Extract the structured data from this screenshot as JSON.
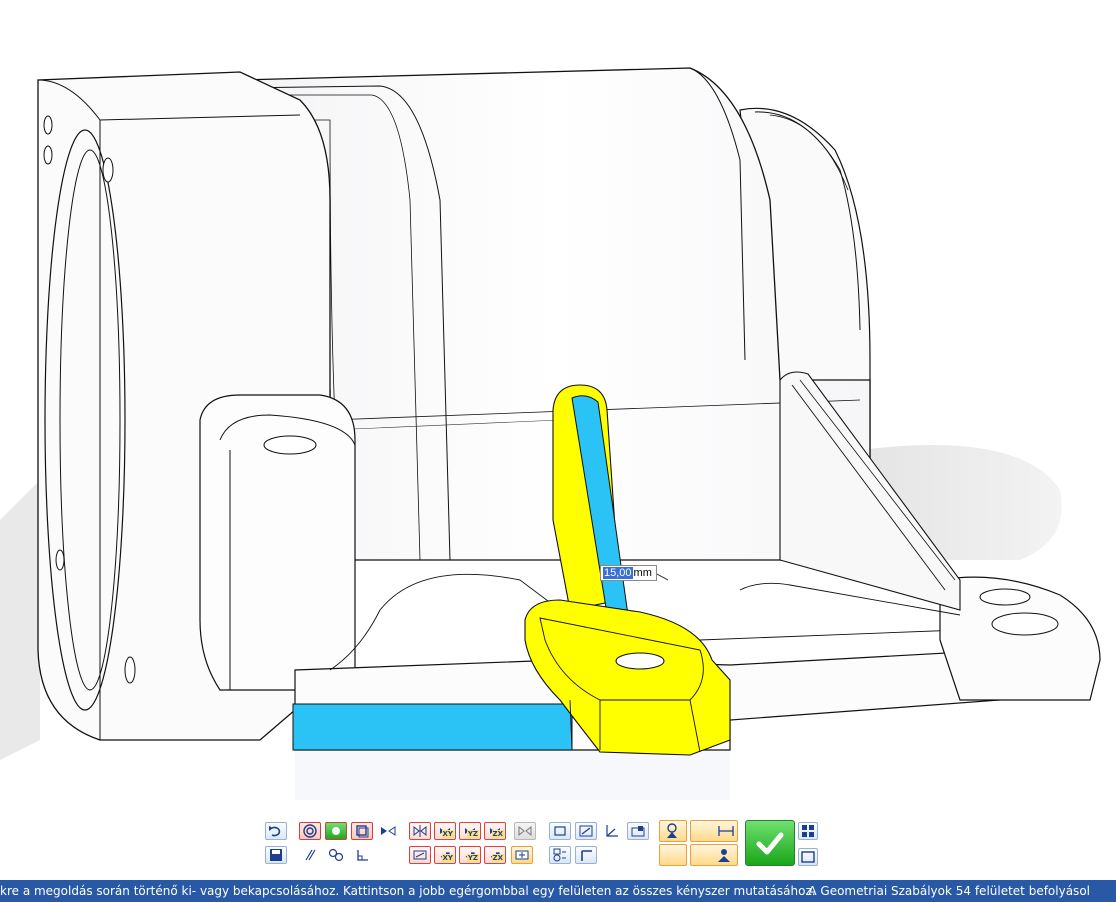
{
  "dimension": {
    "value": "15,00",
    "unit": "mm"
  },
  "statusbar": {
    "message": "kre a megoldás során történő ki- vagy bekapcsolásához. Kattintson a jobb egérgombbal egy felületen az összes kényszer mutatásához.",
    "right": "A Geometriai Szabályok 54 felületet befolyásol"
  },
  "toolbar": {
    "xy": "XY",
    "yz": "YZ",
    "zx": "ZX",
    "xy2": "XY",
    "yz2": "YZ",
    "zx2": "ZX"
  },
  "colors": {
    "highlight_yellow": "#ffff00",
    "selected_cyan": "#2bc3f5",
    "status_blue": "#2859a6",
    "accept_green": "#19a619"
  },
  "icons": [
    "undo-icon",
    "save-icon",
    "concentric-icon",
    "tangent-icon",
    "coplanar-icon",
    "symmetric-icon",
    "parallel-icon",
    "perpendicular-icon",
    "offset-icon",
    "accept-check-icon",
    "grid-icon",
    "window-icon"
  ]
}
